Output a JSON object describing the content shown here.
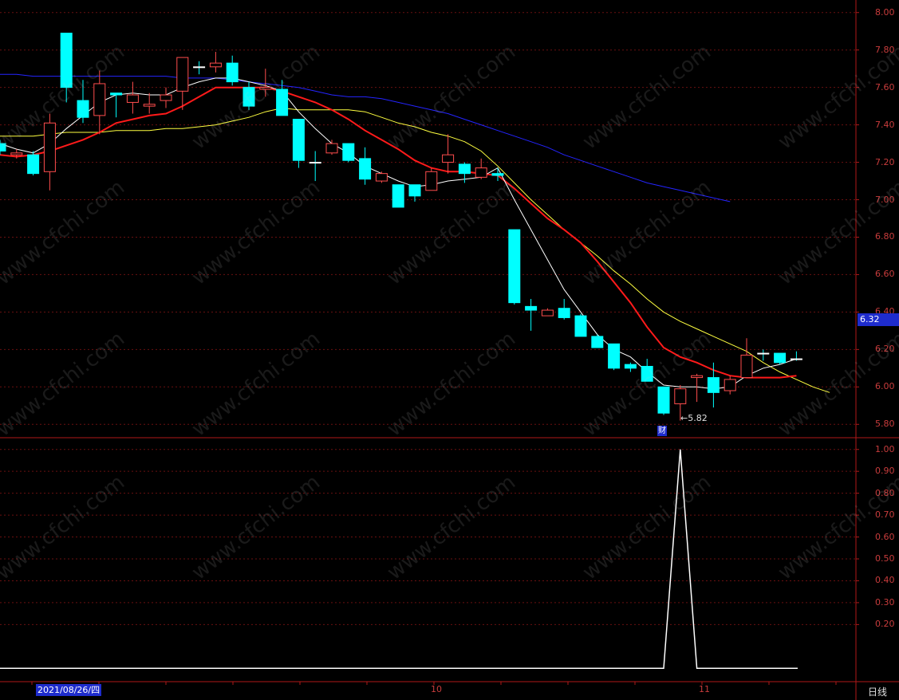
{
  "chart_data": {
    "type": "candlestick",
    "price_axis": {
      "ylim": [
        5.75,
        8.05
      ],
      "ticks": [
        "8.00",
        "7.80",
        "7.60",
        "7.40",
        "7.20",
        "7.00",
        "6.80",
        "6.60",
        "6.40",
        "6.20",
        "6.00",
        "5.80"
      ]
    },
    "indicator_axis": {
      "ylim": [
        -0.05,
        1.05
      ],
      "ticks": [
        "1.00",
        "0.90",
        "0.80",
        "0.70",
        "0.60",
        "0.50",
        "0.40",
        "0.30",
        "0.20"
      ]
    },
    "last_price": "6.32",
    "low_marker": "←5.82",
    "event_badge": "财",
    "date_cursor": "2021/08/26/四",
    "month_labels": [
      "10",
      "11"
    ],
    "period": "日线",
    "watermark": "www.cfchi.com",
    "candles": [
      {
        "o": 7.3,
        "h": 7.32,
        "l": 7.24,
        "c": 7.26
      },
      {
        "o": 7.24,
        "h": 7.27,
        "l": 7.22,
        "c": 7.25
      },
      {
        "o": 7.24,
        "h": 7.26,
        "l": 7.13,
        "c": 7.14
      },
      {
        "o": 7.15,
        "h": 7.46,
        "l": 7.05,
        "c": 7.41
      },
      {
        "o": 7.89,
        "h": 7.89,
        "l": 7.52,
        "c": 7.6
      },
      {
        "o": 7.53,
        "h": 7.64,
        "l": 7.41,
        "c": 7.44
      },
      {
        "o": 7.45,
        "h": 7.69,
        "l": 7.35,
        "c": 7.62
      },
      {
        "o": 7.57,
        "h": 7.57,
        "l": 7.44,
        "c": 7.56
      },
      {
        "o": 7.52,
        "h": 7.63,
        "l": 7.46,
        "c": 7.56
      },
      {
        "o": 7.5,
        "h": 7.57,
        "l": 7.46,
        "c": 7.51
      },
      {
        "o": 7.53,
        "h": 7.6,
        "l": 7.49,
        "c": 7.56
      },
      {
        "o": 7.58,
        "h": 7.76,
        "l": 7.48,
        "c": 7.76
      },
      {
        "o": 7.71,
        "h": 7.74,
        "l": 7.67,
        "c": 7.71
      },
      {
        "o": 7.71,
        "h": 7.79,
        "l": 7.68,
        "c": 7.73
      },
      {
        "o": 7.73,
        "h": 7.77,
        "l": 7.61,
        "c": 7.63
      },
      {
        "o": 7.6,
        "h": 7.63,
        "l": 7.48,
        "c": 7.5
      },
      {
        "o": 7.59,
        "h": 7.7,
        "l": 7.55,
        "c": 7.6
      },
      {
        "o": 7.59,
        "h": 7.64,
        "l": 7.45,
        "c": 7.45
      },
      {
        "o": 7.43,
        "h": 7.43,
        "l": 7.17,
        "c": 7.21
      },
      {
        "o": 7.2,
        "h": 7.26,
        "l": 7.1,
        "c": 7.2
      },
      {
        "o": 7.25,
        "h": 7.32,
        "l": 7.24,
        "c": 7.3
      },
      {
        "o": 7.3,
        "h": 7.3,
        "l": 7.2,
        "c": 7.21
      },
      {
        "o": 7.22,
        "h": 7.28,
        "l": 7.08,
        "c": 7.11
      },
      {
        "o": 7.1,
        "h": 7.15,
        "l": 7.09,
        "c": 7.14
      },
      {
        "o": 7.08,
        "h": 7.08,
        "l": 6.96,
        "c": 6.96
      },
      {
        "o": 7.08,
        "h": 7.08,
        "l": 6.99,
        "c": 7.02
      },
      {
        "o": 7.05,
        "h": 7.17,
        "l": 7.05,
        "c": 7.15
      },
      {
        "o": 7.2,
        "h": 7.35,
        "l": 7.14,
        "c": 7.24
      },
      {
        "o": 7.19,
        "h": 7.2,
        "l": 7.09,
        "c": 7.14
      },
      {
        "o": 7.12,
        "h": 7.22,
        "l": 7.11,
        "c": 7.17
      },
      {
        "o": 7.14,
        "h": 7.17,
        "l": 7.1,
        "c": 7.13
      },
      {
        "o": 6.84,
        "h": 6.84,
        "l": 6.44,
        "c": 6.45
      },
      {
        "o": 6.43,
        "h": 6.47,
        "l": 6.3,
        "c": 6.41
      },
      {
        "o": 6.38,
        "h": 6.42,
        "l": 6.38,
        "c": 6.41
      },
      {
        "o": 6.42,
        "h": 6.47,
        "l": 6.36,
        "c": 6.37
      },
      {
        "o": 6.38,
        "h": 6.39,
        "l": 6.27,
        "c": 6.27
      },
      {
        "o": 6.27,
        "h": 6.28,
        "l": 6.21,
        "c": 6.21
      },
      {
        "o": 6.23,
        "h": 6.23,
        "l": 6.09,
        "c": 6.1
      },
      {
        "o": 6.12,
        "h": 6.13,
        "l": 6.08,
        "c": 6.1
      },
      {
        "o": 6.11,
        "h": 6.15,
        "l": 6.03,
        "c": 6.03
      },
      {
        "o": 6.0,
        "h": 6.0,
        "l": 5.85,
        "c": 5.86
      },
      {
        "o": 5.91,
        "h": 6.01,
        "l": 5.82,
        "c": 5.99
      },
      {
        "o": 6.05,
        "h": 6.07,
        "l": 5.92,
        "c": 6.06
      },
      {
        "o": 6.05,
        "h": 6.13,
        "l": 5.89,
        "c": 5.97
      },
      {
        "o": 5.98,
        "h": 6.06,
        "l": 5.96,
        "c": 6.04
      },
      {
        "o": 6.05,
        "h": 6.26,
        "l": 6.05,
        "c": 6.17
      },
      {
        "o": 6.18,
        "h": 6.2,
        "l": 6.14,
        "c": 6.18
      },
      {
        "o": 6.18,
        "h": 6.18,
        "l": 6.12,
        "c": 6.13
      },
      {
        "o": 6.15,
        "h": 6.19,
        "l": 6.14,
        "c": 6.15
      }
    ],
    "series": [
      {
        "color": "#ffffff",
        "values": [
          7.3,
          7.27,
          7.25,
          7.3,
          7.38,
          7.45,
          7.52,
          7.56,
          7.57,
          7.56,
          7.56,
          7.6,
          7.63,
          7.65,
          7.65,
          7.63,
          7.61,
          7.58,
          7.47,
          7.38,
          7.3,
          7.25,
          7.18,
          7.14,
          7.1,
          7.07,
          7.08,
          7.1,
          7.11,
          7.12,
          7.17,
          7.0,
          6.84,
          6.68,
          6.52,
          6.4,
          6.28,
          6.2,
          6.16,
          6.08,
          6.01,
          6.0,
          6.0,
          5.99,
          6.0,
          6.06,
          6.1,
          6.12,
          6.15
        ]
      },
      {
        "color": "#ff1a1a",
        "values": [
          7.24,
          7.23,
          7.24,
          7.26,
          7.29,
          7.32,
          7.36,
          7.41,
          7.43,
          7.45,
          7.46,
          7.5,
          7.55,
          7.6,
          7.6,
          7.6,
          7.6,
          7.58,
          7.55,
          7.52,
          7.48,
          7.43,
          7.37,
          7.32,
          7.27,
          7.21,
          7.17,
          7.15,
          7.15,
          7.14,
          7.13,
          7.06,
          6.98,
          6.9,
          6.84,
          6.77,
          6.67,
          6.56,
          6.45,
          6.32,
          6.21,
          6.16,
          6.13,
          6.09,
          6.06,
          6.05,
          6.05,
          6.05,
          6.06
        ]
      },
      {
        "color": "#ffff40",
        "values": [
          7.34,
          7.34,
          7.34,
          7.35,
          7.36,
          7.36,
          7.36,
          7.37,
          7.37,
          7.37,
          7.38,
          7.38,
          7.39,
          7.4,
          7.42,
          7.44,
          7.47,
          7.49,
          7.48,
          7.48,
          7.48,
          7.48,
          7.47,
          7.44,
          7.41,
          7.39,
          7.36,
          7.34,
          7.31,
          7.26,
          7.18,
          7.09,
          7.0,
          6.92,
          6.84,
          6.77,
          6.7,
          6.62,
          6.55,
          6.47,
          6.4,
          6.35,
          6.31,
          6.27,
          6.23,
          6.19,
          6.13,
          6.08,
          6.04,
          6.0,
          5.97
        ]
      },
      {
        "color": "#2424ff",
        "values": [
          7.67,
          7.67,
          7.66,
          7.66,
          7.66,
          7.66,
          7.66,
          7.66,
          7.66,
          7.66,
          7.66,
          7.65,
          7.65,
          7.65,
          7.64,
          7.63,
          7.62,
          7.61,
          7.6,
          7.58,
          7.56,
          7.55,
          7.55,
          7.54,
          7.52,
          7.5,
          7.48,
          7.46,
          7.43,
          7.4,
          7.37,
          7.34,
          7.31,
          7.28,
          7.24,
          7.21,
          7.18,
          7.15,
          7.12,
          7.09,
          7.07,
          7.05,
          7.03,
          7.01,
          6.99
        ]
      }
    ],
    "indicator": {
      "color": "#ffffff",
      "values": [
        0,
        0,
        0,
        0,
        0,
        0,
        0,
        0,
        0,
        0,
        0,
        0,
        0,
        0,
        0,
        0,
        0,
        0,
        0,
        0,
        0,
        0,
        0,
        0,
        0,
        0,
        0,
        0,
        0,
        0,
        0,
        0,
        0,
        0,
        0,
        0,
        0,
        0,
        0,
        0,
        0,
        1,
        0,
        0,
        0,
        0,
        0,
        0,
        0
      ]
    }
  }
}
